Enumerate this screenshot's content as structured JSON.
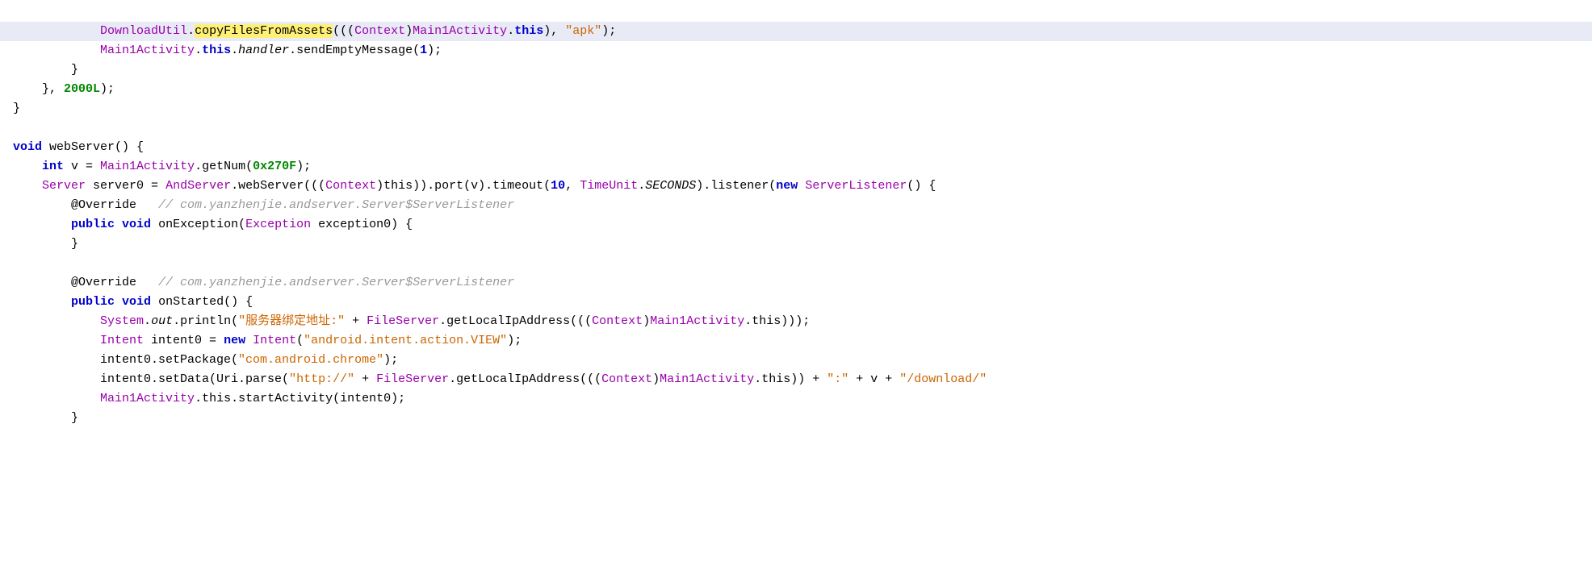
{
  "code": {
    "lines": [
      {
        "id": 1,
        "highlighted": true,
        "tokens": [
          {
            "t": "            ",
            "c": "plain"
          },
          {
            "t": "DownloadUtil",
            "c": "class-ref"
          },
          {
            "t": ".",
            "c": "plain"
          },
          {
            "t": "copyFilesFromAssets",
            "c": "method",
            "highlight": true
          },
          {
            "t": "(((",
            "c": "plain"
          },
          {
            "t": "Context",
            "c": "class-ref"
          },
          {
            "t": ")",
            "c": "plain"
          },
          {
            "t": "Main1Activity",
            "c": "class-ref"
          },
          {
            "t": ".",
            "c": "plain"
          },
          {
            "t": "this",
            "c": "kw"
          },
          {
            "t": "), ",
            "c": "plain"
          },
          {
            "t": "\"apk\"",
            "c": "string"
          },
          {
            "t": ");",
            "c": "plain"
          }
        ]
      },
      {
        "id": 2,
        "highlighted": false,
        "tokens": [
          {
            "t": "            ",
            "c": "plain"
          },
          {
            "t": "Main1Activity",
            "c": "class-ref"
          },
          {
            "t": ".",
            "c": "plain"
          },
          {
            "t": "this",
            "c": "kw"
          },
          {
            "t": ".",
            "c": "plain"
          },
          {
            "t": "handler",
            "c": "italic plain"
          },
          {
            "t": ".sendEmptyMessage(",
            "c": "plain"
          },
          {
            "t": "1",
            "c": "num"
          },
          {
            "t": ");",
            "c": "plain"
          }
        ]
      },
      {
        "id": 3,
        "highlighted": false,
        "tokens": [
          {
            "t": "        }",
            "c": "plain"
          }
        ]
      },
      {
        "id": 4,
        "highlighted": false,
        "tokens": [
          {
            "t": "    }, ",
            "c": "plain"
          },
          {
            "t": "2000L",
            "c": "num-green"
          },
          {
            "t": ");",
            "c": "plain"
          }
        ]
      },
      {
        "id": 5,
        "highlighted": false,
        "tokens": [
          {
            "t": "}",
            "c": "plain"
          }
        ]
      },
      {
        "id": 6,
        "highlighted": false,
        "tokens": []
      },
      {
        "id": 7,
        "highlighted": false,
        "tokens": [
          {
            "t": "void",
            "c": "kw"
          },
          {
            "t": " webServer() {",
            "c": "plain"
          }
        ]
      },
      {
        "id": 8,
        "highlighted": false,
        "tokens": [
          {
            "t": "    ",
            "c": "plain"
          },
          {
            "t": "int",
            "c": "kw"
          },
          {
            "t": " v = ",
            "c": "plain"
          },
          {
            "t": "Main1Activity",
            "c": "class-ref"
          },
          {
            "t": ".getNum(",
            "c": "plain"
          },
          {
            "t": "0x270F",
            "c": "num-green"
          },
          {
            "t": ");",
            "c": "plain"
          }
        ]
      },
      {
        "id": 9,
        "highlighted": false,
        "tokens": [
          {
            "t": "    ",
            "c": "plain"
          },
          {
            "t": "Server",
            "c": "class-ref"
          },
          {
            "t": " server0 = ",
            "c": "plain"
          },
          {
            "t": "AndServer",
            "c": "class-ref"
          },
          {
            "t": ".webServer(((",
            "c": "plain"
          },
          {
            "t": "Context",
            "c": "class-ref"
          },
          {
            "t": ")this)).port(v).timeout(",
            "c": "plain"
          },
          {
            "t": "10",
            "c": "num"
          },
          {
            "t": ", ",
            "c": "plain"
          },
          {
            "t": "TimeUnit",
            "c": "class-ref"
          },
          {
            "t": ".",
            "c": "plain"
          },
          {
            "t": "SECONDS",
            "c": "italic plain"
          },
          {
            "t": ").listener(",
            "c": "plain"
          },
          {
            "t": "new",
            "c": "kw"
          },
          {
            "t": " ",
            "c": "plain"
          },
          {
            "t": "ServerListener",
            "c": "class-ref"
          },
          {
            "t": "() {",
            "c": "plain"
          }
        ]
      },
      {
        "id": 10,
        "highlighted": false,
        "tokens": [
          {
            "t": "        ",
            "c": "plain"
          },
          {
            "t": "@Override",
            "c": "plain"
          },
          {
            "t": "   ",
            "c": "plain"
          },
          {
            "t": "// com.yanzhenjie.andserver.Server$ServerListener",
            "c": "comment"
          }
        ]
      },
      {
        "id": 11,
        "highlighted": false,
        "tokens": [
          {
            "t": "        ",
            "c": "plain"
          },
          {
            "t": "public",
            "c": "kw"
          },
          {
            "t": " ",
            "c": "plain"
          },
          {
            "t": "void",
            "c": "kw"
          },
          {
            "t": " onException(",
            "c": "plain"
          },
          {
            "t": "Exception",
            "c": "class-ref"
          },
          {
            "t": " exception0) {",
            "c": "plain"
          }
        ]
      },
      {
        "id": 12,
        "highlighted": false,
        "tokens": [
          {
            "t": "        }",
            "c": "plain"
          }
        ]
      },
      {
        "id": 13,
        "highlighted": false,
        "tokens": []
      },
      {
        "id": 14,
        "highlighted": false,
        "tokens": [
          {
            "t": "        ",
            "c": "plain"
          },
          {
            "t": "@Override",
            "c": "plain"
          },
          {
            "t": "   ",
            "c": "plain"
          },
          {
            "t": "// com.yanzhenjie.andserver.Server$ServerListener",
            "c": "comment"
          }
        ]
      },
      {
        "id": 15,
        "highlighted": false,
        "tokens": [
          {
            "t": "        ",
            "c": "plain"
          },
          {
            "t": "public",
            "c": "kw"
          },
          {
            "t": " ",
            "c": "plain"
          },
          {
            "t": "void",
            "c": "kw"
          },
          {
            "t": " onStarted() {",
            "c": "plain"
          }
        ]
      },
      {
        "id": 16,
        "highlighted": false,
        "tokens": [
          {
            "t": "            ",
            "c": "plain"
          },
          {
            "t": "System",
            "c": "class-ref"
          },
          {
            "t": ".",
            "c": "plain"
          },
          {
            "t": "out",
            "c": "italic plain"
          },
          {
            "t": ".println(",
            "c": "plain"
          },
          {
            "t": "\"服务器绑定地址:\"",
            "c": "string"
          },
          {
            "t": " + ",
            "c": "plain"
          },
          {
            "t": "FileServer",
            "c": "class-ref"
          },
          {
            "t": ".getLocalIpAddress(((",
            "c": "plain"
          },
          {
            "t": "Context",
            "c": "class-ref"
          },
          {
            "t": ")",
            "c": "plain"
          },
          {
            "t": "Main1Activity",
            "c": "class-ref"
          },
          {
            "t": ".this)));",
            "c": "plain"
          }
        ]
      },
      {
        "id": 17,
        "highlighted": false,
        "tokens": [
          {
            "t": "            ",
            "c": "plain"
          },
          {
            "t": "Intent",
            "c": "class-ref"
          },
          {
            "t": " intent0 = ",
            "c": "plain"
          },
          {
            "t": "new",
            "c": "kw"
          },
          {
            "t": " ",
            "c": "plain"
          },
          {
            "t": "Intent",
            "c": "class-ref"
          },
          {
            "t": "(",
            "c": "plain"
          },
          {
            "t": "\"android.intent.action.VIEW\"",
            "c": "string"
          },
          {
            "t": ");",
            "c": "plain"
          }
        ]
      },
      {
        "id": 18,
        "highlighted": false,
        "tokens": [
          {
            "t": "            intent0.setPackage(",
            "c": "plain"
          },
          {
            "t": "\"com.android.chrome\"",
            "c": "string"
          },
          {
            "t": ");",
            "c": "plain"
          }
        ]
      },
      {
        "id": 19,
        "highlighted": false,
        "tokens": [
          {
            "t": "            intent0.setData(Uri.parse(",
            "c": "plain"
          },
          {
            "t": "\"http://\"",
            "c": "string"
          },
          {
            "t": " + ",
            "c": "plain"
          },
          {
            "t": "FileServer",
            "c": "class-ref"
          },
          {
            "t": ".getLocalIpAddress(((",
            "c": "plain"
          },
          {
            "t": "Context",
            "c": "class-ref"
          },
          {
            "t": ")",
            "c": "plain"
          },
          {
            "t": "Main1Activity",
            "c": "class-ref"
          },
          {
            "t": ".this)) + ",
            "c": "plain"
          },
          {
            "t": "\":\"",
            "c": "string"
          },
          {
            "t": " + v + ",
            "c": "plain"
          },
          {
            "t": "\"/download/\"",
            "c": "string"
          }
        ]
      },
      {
        "id": 20,
        "highlighted": false,
        "tokens": [
          {
            "t": "            ",
            "c": "plain"
          },
          {
            "t": "Main1Activity",
            "c": "class-ref"
          },
          {
            "t": ".this.startActivity(intent0);",
            "c": "plain"
          }
        ]
      },
      {
        "id": 21,
        "highlighted": false,
        "tokens": [
          {
            "t": "        }",
            "c": "plain"
          }
        ]
      }
    ]
  }
}
